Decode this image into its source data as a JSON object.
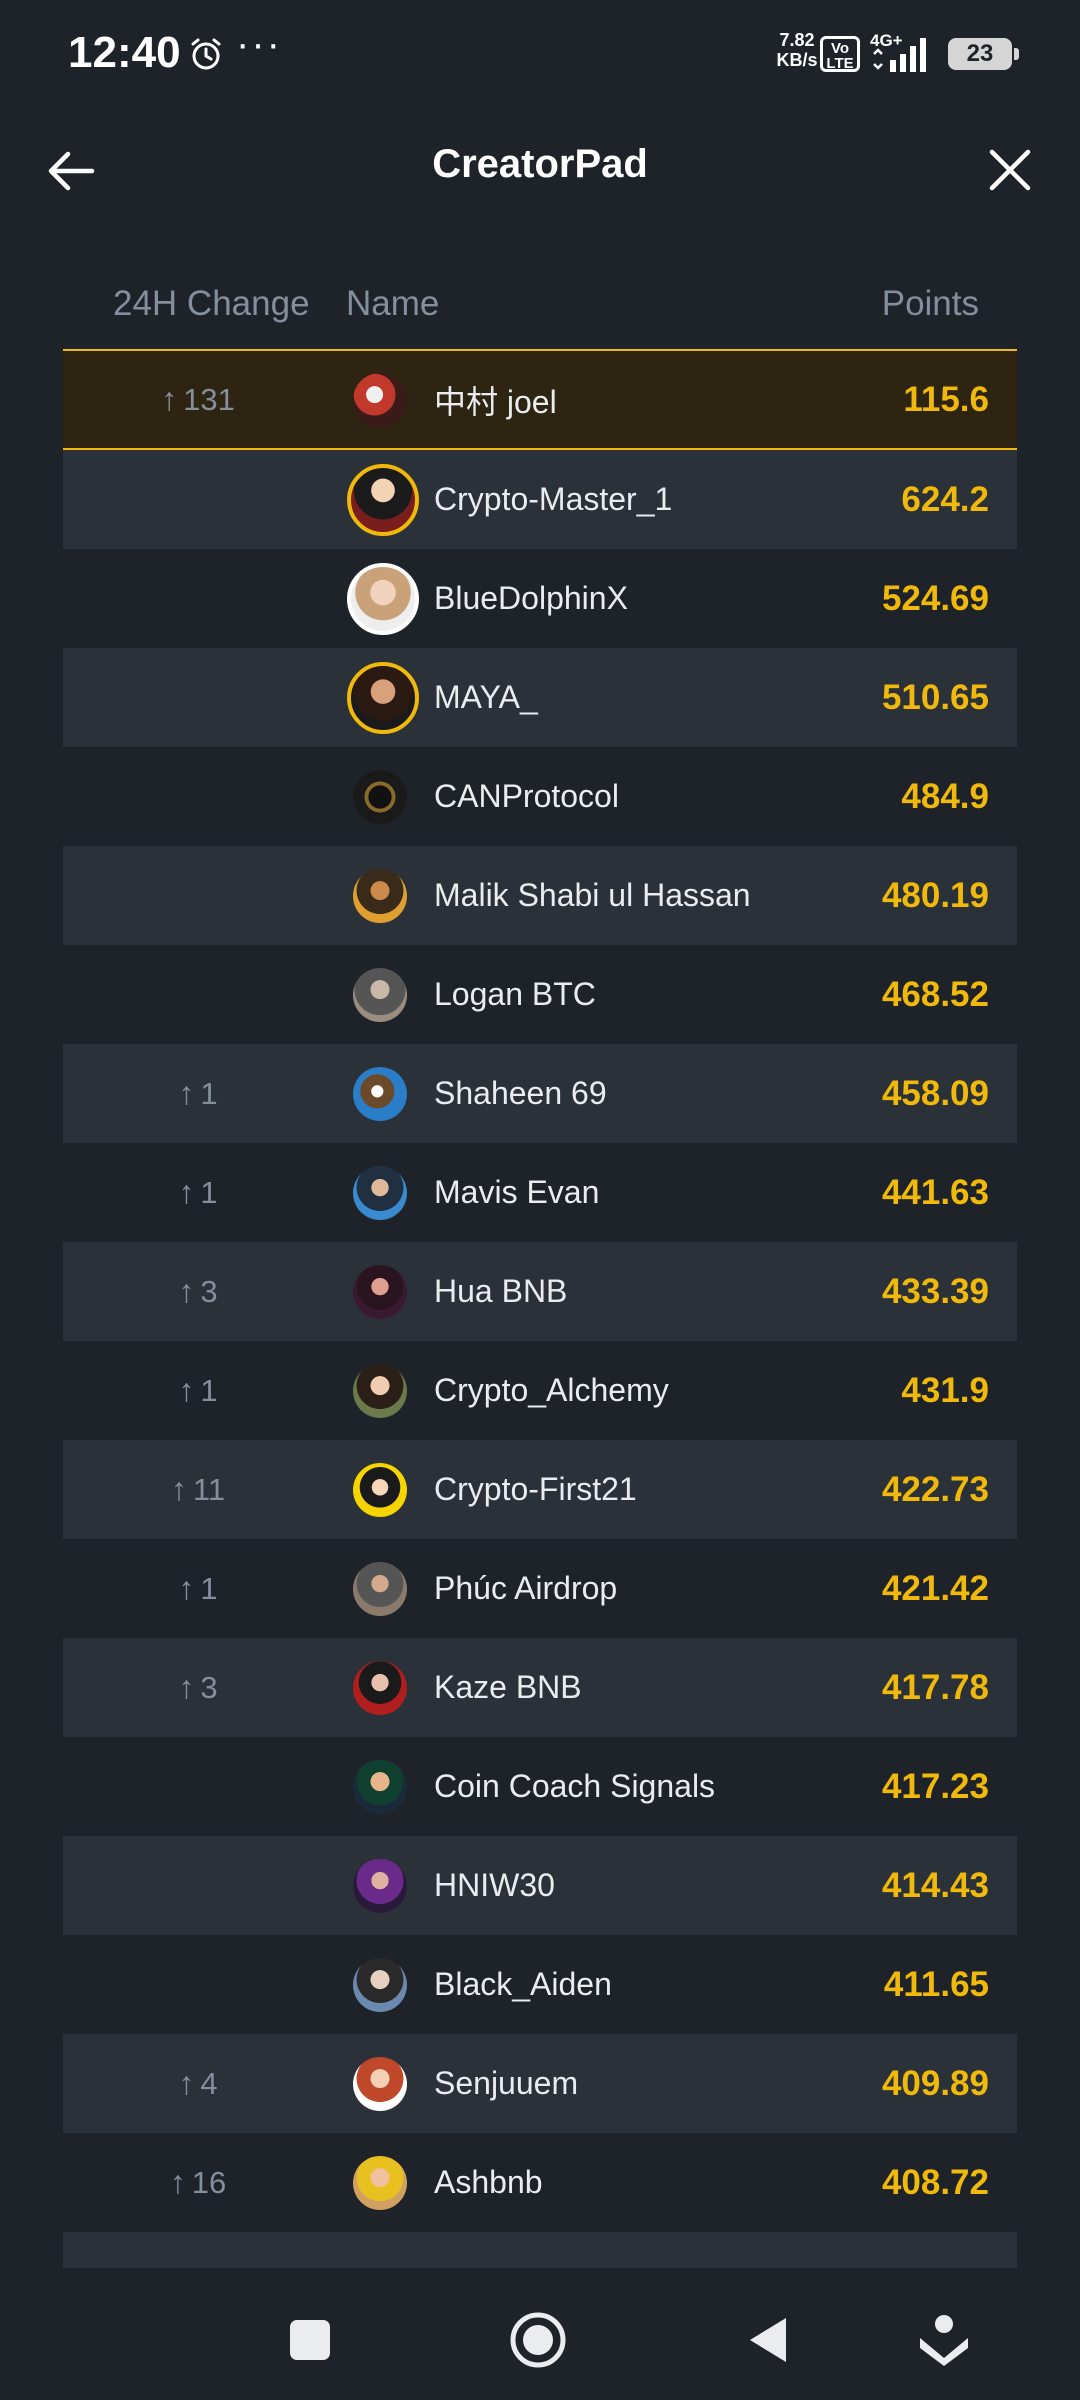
{
  "status_bar": {
    "time": "12:40",
    "more": "···",
    "net_speed_value": "7.82",
    "net_speed_unit": "KB/s",
    "volte_top": "Vo",
    "volte_bottom": "LTE",
    "network": "4G+",
    "battery": "23"
  },
  "header": {
    "title": "CreatorPad"
  },
  "table": {
    "col_change": "24H Change",
    "col_name": "Name",
    "col_points": "Points"
  },
  "rows": [
    {
      "change": "131",
      "name": "中村 joel",
      "points": "115.6"
    },
    {
      "change": "",
      "name": "Crypto-Master_1",
      "points": "624.2"
    },
    {
      "change": "",
      "name": "BlueDolphinX",
      "points": "524.69"
    },
    {
      "change": "",
      "name": "MAYA_",
      "points": "510.65"
    },
    {
      "change": "",
      "name": "CANProtocol",
      "points": "484.9"
    },
    {
      "change": "",
      "name": "Malik Shabi ul Hassan",
      "points": "480.19"
    },
    {
      "change": "",
      "name": "Logan BTC",
      "points": "468.52"
    },
    {
      "change": "1",
      "name": "Shaheen 69",
      "points": "458.09"
    },
    {
      "change": "1",
      "name": "Mavis Evan",
      "points": "441.63"
    },
    {
      "change": "3",
      "name": "Hua BNB",
      "points": "433.39"
    },
    {
      "change": "1",
      "name": "Crypto_Alchemy",
      "points": "431.9"
    },
    {
      "change": "11",
      "name": "Crypto-First21",
      "points": "422.73"
    },
    {
      "change": "1",
      "name": "Phúc Airdrop",
      "points": "421.42"
    },
    {
      "change": "3",
      "name": "Kaze BNB",
      "points": "417.78"
    },
    {
      "change": "",
      "name": "Coin Coach Signals",
      "points": "417.23"
    },
    {
      "change": "",
      "name": "HNIW30",
      "points": "414.43"
    },
    {
      "change": "",
      "name": "Black_Aiden",
      "points": "411.65"
    },
    {
      "change": "4",
      "name": "Senjuuem",
      "points": "409.89"
    },
    {
      "change": "16",
      "name": "Ashbnb",
      "points": "408.72"
    }
  ],
  "colors": {
    "background": "#1e2329",
    "row_alt": "#2b3139",
    "highlight_bg": "#2d2412",
    "accent": "#f0b90b",
    "muted": "#848e9c"
  }
}
